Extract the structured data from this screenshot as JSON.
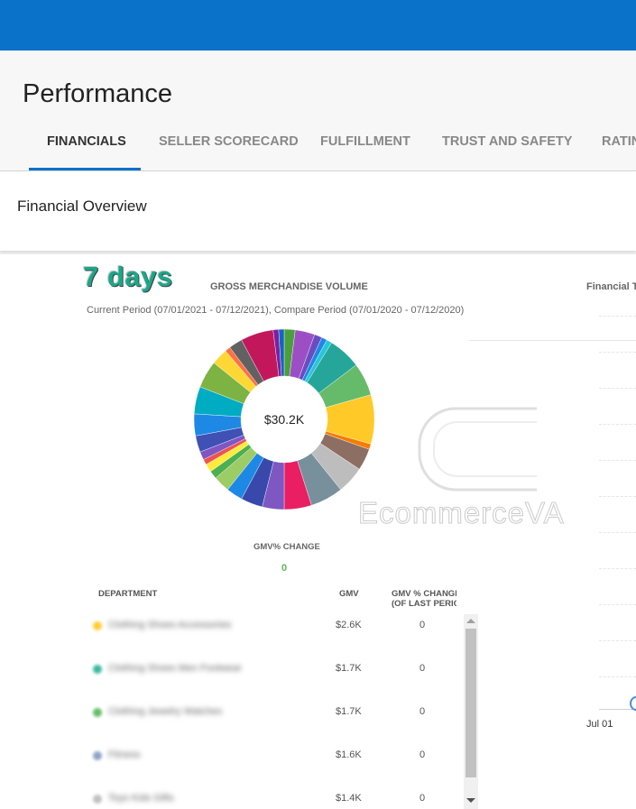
{
  "page_title": "Performance",
  "tabs": [
    {
      "label": "FINANCIALS",
      "active": true
    },
    {
      "label": "SELLER SCORECARD",
      "active": false
    },
    {
      "label": "FULFILLMENT",
      "active": false
    },
    {
      "label": "TRUST AND SAFETY",
      "active": false
    },
    {
      "label": "RATIN",
      "active": false
    }
  ],
  "overview": {
    "title": "Financial Overview",
    "range_label": "7 days"
  },
  "gmv_chart": {
    "title": "GROSS MERCHANDISE VOLUME",
    "period": "Current Period (07/01/2021 - 07/12/2021), Compare Period (07/01/2020 - 07/12/2020)",
    "center_total": "$30.2K",
    "change_title": "GMV% CHANGE",
    "change_value": "0"
  },
  "watermark": "EcommerceVA",
  "trend_chart": {
    "title": "Financial T",
    "x_tick": "Jul 01"
  },
  "table": {
    "headers": {
      "department": "DEPARTMENT",
      "gmv": "GMV",
      "change_line1": "GMV % CHANGE",
      "change_line2": "(OF LAST PERIOD"
    },
    "rows": [
      {
        "name": "Clothing Shoes Accessories",
        "color": "#ffcc33",
        "gmv": "$2.6K",
        "change": "0"
      },
      {
        "name": "Clothing Shoes Men Footwear",
        "color": "#3cb8a0",
        "gmv": "$1.7K",
        "change": "0"
      },
      {
        "name": "Clothing Jewelry Watches",
        "color": "#66bb6a",
        "gmv": "$1.7K",
        "change": "0"
      },
      {
        "name": "Fitness",
        "color": "#8fa3c8",
        "gmv": "$1.6K",
        "change": "0"
      },
      {
        "name": "Toys Kids Gifts",
        "color": "#c0c0c0",
        "gmv": "$1.4K",
        "change": "0"
      }
    ]
  },
  "chart_data": {
    "type": "pie",
    "title": "GROSS MERCHANDISE VOLUME",
    "total": "$30.2K",
    "slices": [
      {
        "color": "#4a9e3c",
        "value": 2.0
      },
      {
        "color": "#9c4fc4",
        "value": 3.6
      },
      {
        "color": "#6a4cc0",
        "value": 1.4
      },
      {
        "color": "#1e88e5",
        "value": 1.0
      },
      {
        "color": "#26c6da",
        "value": 1.0
      },
      {
        "color": "#26a69a",
        "value": 6.0
      },
      {
        "color": "#66bb6a",
        "value": 6.0
      },
      {
        "color": "#ffca28",
        "value": 9.0
      },
      {
        "color": "#f57c00",
        "value": 1.0
      },
      {
        "color": "#8d6e63",
        "value": 4.0
      },
      {
        "color": "#bdbdbd",
        "value": 5.0
      },
      {
        "color": "#78909c",
        "value": 6.0
      },
      {
        "color": "#e91e63",
        "value": 5.0
      },
      {
        "color": "#7e57c2",
        "value": 4.0
      },
      {
        "color": "#3949ab",
        "value": 4.0
      },
      {
        "color": "#1e88e5",
        "value": 3.0
      },
      {
        "color": "#9ccc65",
        "value": 3.0
      },
      {
        "color": "#4caf50",
        "value": 1.5
      },
      {
        "color": "#ffeb3b",
        "value": 1.5
      },
      {
        "color": "#ef5350",
        "value": 1.0
      },
      {
        "color": "#7e57c2",
        "value": 1.5
      },
      {
        "color": "#3f51b5",
        "value": 3.0
      },
      {
        "color": "#1e88e5",
        "value": 4.0
      },
      {
        "color": "#00acc1",
        "value": 5.0
      },
      {
        "color": "#7cb342",
        "value": 5.0
      },
      {
        "color": "#fdd835",
        "value": 3.0
      },
      {
        "color": "#ff7043",
        "value": 1.0
      },
      {
        "color": "#616161",
        "value": 2.5
      },
      {
        "color": "#c2185b",
        "value": 6.0
      },
      {
        "color": "#7b1fa2",
        "value": 1.0
      },
      {
        "color": "#1565c0",
        "value": 1.0
      }
    ]
  }
}
